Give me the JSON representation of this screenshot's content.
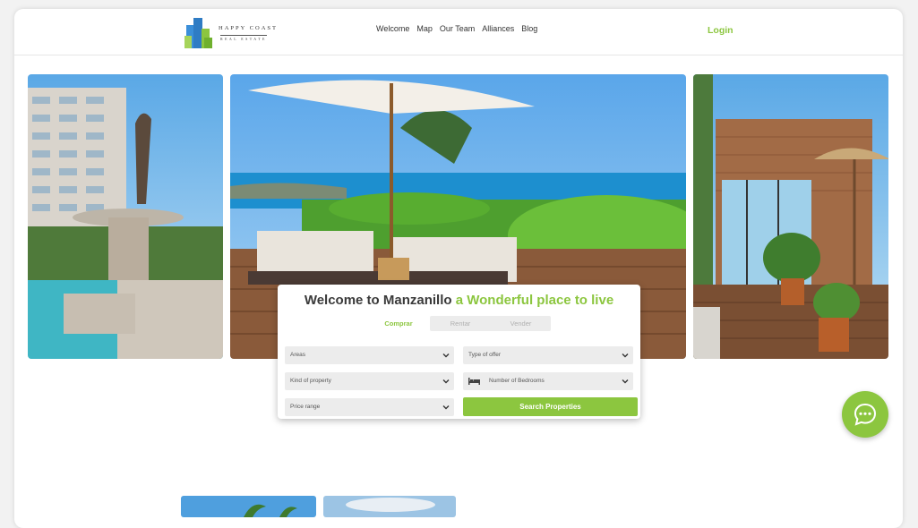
{
  "brand": {
    "name": "HAPPY COAST",
    "tagline": "REAL ESTATE",
    "colors": {
      "accent": "#8cc63f",
      "blue": "#3b8fd9"
    }
  },
  "nav": {
    "items": [
      {
        "label": "Welcome"
      },
      {
        "label": "Map"
      },
      {
        "label": "Our Team"
      },
      {
        "label": "Alliances"
      },
      {
        "label": "Blog"
      }
    ],
    "login": "Login"
  },
  "search": {
    "title_main": "Welcome to Manzanillo",
    "title_accent": "a Wonderful place to live",
    "tabs": [
      {
        "label": "Comprar"
      },
      {
        "label": "Rentar"
      },
      {
        "label": "Vender"
      }
    ],
    "fields": {
      "areas": "Areas",
      "type_of_offer": "Type of offer",
      "kind_of_property": "Kind of property",
      "bedrooms": "Number of Bedrooms",
      "price_range": "Price range"
    },
    "button": "Search Properties"
  },
  "icons": {
    "chat": "chat-bubble-icon",
    "chevron": "chevron-down-icon",
    "bed": "bed-icon"
  }
}
